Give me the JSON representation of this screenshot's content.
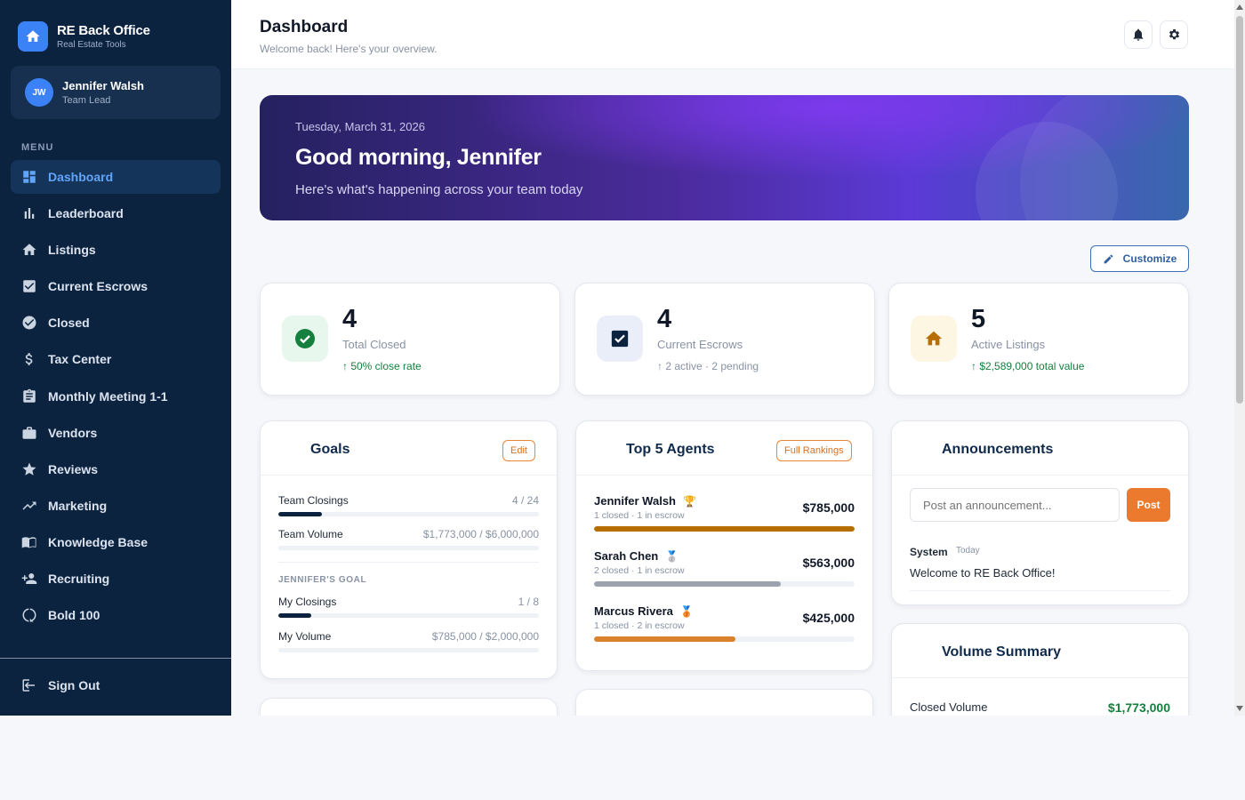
{
  "brand": {
    "name": "RE Back Office",
    "subtitle": "Real Estate Tools"
  },
  "user": {
    "initials": "JW",
    "name": "Jennifer Walsh",
    "role": "Team Lead"
  },
  "menu_label": "MENU",
  "nav": [
    {
      "label": "Dashboard",
      "icon": "dashboard-icon",
      "active": true
    },
    {
      "label": "Leaderboard",
      "icon": "bar-chart-icon"
    },
    {
      "label": "Listings",
      "icon": "home-icon"
    },
    {
      "label": "Current Escrows",
      "icon": "checkbox-icon"
    },
    {
      "label": "Closed",
      "icon": "check-circle-icon"
    },
    {
      "label": "Tax Center",
      "icon": "dollar-icon"
    },
    {
      "label": "Monthly Meeting 1-1",
      "icon": "clipboard-icon"
    },
    {
      "label": "Vendors",
      "icon": "briefcase-icon"
    },
    {
      "label": "Reviews",
      "icon": "star-icon"
    },
    {
      "label": "Marketing",
      "icon": "trending-up-icon"
    },
    {
      "label": "Knowledge Base",
      "icon": "book-icon"
    },
    {
      "label": "Recruiting",
      "icon": "person-add-icon"
    },
    {
      "label": "Bold 100",
      "icon": "progress-circle-icon"
    }
  ],
  "signout": "Sign Out",
  "header": {
    "title": "Dashboard",
    "subtitle": "Welcome back! Here's your overview."
  },
  "hero": {
    "date": "Tuesday, March 31, 2026",
    "greeting": "Good morning, Jennifer",
    "subtitle": "Here's what's happening across your team today"
  },
  "customize_label": "Customize",
  "stats": [
    {
      "value": "4",
      "label": "Total Closed",
      "note": "↑ 50% close rate",
      "note_color": "#15803d",
      "icon": "check-circle-icon",
      "icon_bg": "#e8f7ee",
      "icon_color": "#15803d"
    },
    {
      "value": "4",
      "label": "Current Escrows",
      "note": "↑ 2 active · 2 pending",
      "note_color": "#8892a3",
      "icon": "checkbox-icon",
      "icon_bg": "#e9eef8",
      "icon_color": "#0c2340"
    },
    {
      "value": "5",
      "label": "Active Listings",
      "note": "↑ $2,589,000 total value",
      "note_color": "#15803d",
      "icon": "home-icon",
      "icon_bg": "#fdf6e3",
      "icon_color": "#b76e00"
    }
  ],
  "goals": {
    "title": "Goals",
    "edit_label": "Edit",
    "team": [
      {
        "label": "Team Closings",
        "value": "4 / 24",
        "progress": 0.167
      },
      {
        "label": "Team Volume",
        "value": "$1,773,000 / $6,000,000",
        "progress": 0.0
      }
    ],
    "section_label": "JENNIFER'S GOAL",
    "mine": [
      {
        "label": "My Closings",
        "value": "1 / 8",
        "progress": 0.125
      },
      {
        "label": "My Volume",
        "value": "$785,000 / $2,000,000",
        "progress": 0.0
      }
    ]
  },
  "top_agents": {
    "title": "Top 5 Agents",
    "rankings_label": "Full Rankings",
    "agents": [
      {
        "name": "Jennifer Walsh",
        "medal": "🏆",
        "sub": "1 closed · 1 in escrow",
        "amount": "$785,000",
        "progress": 1.0,
        "color": "#b76e00"
      },
      {
        "name": "Sarah Chen",
        "medal": "🥈",
        "sub": "2 closed · 1 in escrow",
        "amount": "$563,000",
        "progress": 0.717,
        "color": "#9ca3af"
      },
      {
        "name": "Marcus Rivera",
        "medal": "🥉",
        "sub": "1 closed · 2 in escrow",
        "amount": "$425,000",
        "progress": 0.541,
        "color": "#d9822b"
      }
    ]
  },
  "announcements": {
    "title": "Announcements",
    "placeholder": "Post an announcement...",
    "post_label": "Post",
    "items": [
      {
        "author": "System",
        "time": "Today",
        "message": "Welcome to RE Back Office!"
      }
    ]
  },
  "volume_summary": {
    "title": "Volume Summary",
    "closed_label": "Closed Volume",
    "closed_value": "$1,773,000"
  }
}
